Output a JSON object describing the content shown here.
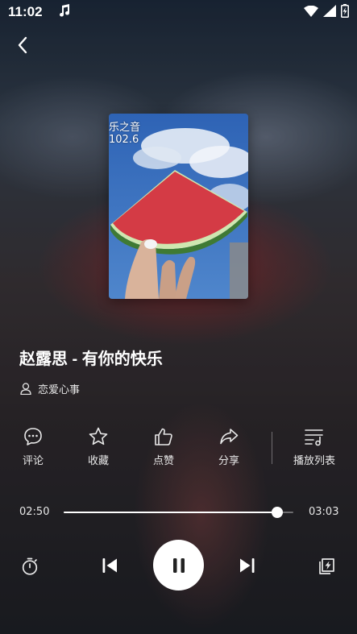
{
  "status": {
    "time": "11:02",
    "music_indicator": "music-note-icon",
    "icons": [
      "wifi-icon",
      "signal-icon",
      "battery-charging-icon"
    ]
  },
  "navigation": {
    "back_icon": "chevron-left-icon"
  },
  "cover": {
    "overlay_line1": "乐之音",
    "overlay_line2": "102.6"
  },
  "song": {
    "title": "赵露思 - 有你的快乐",
    "artist": "恋爱心事"
  },
  "actions": [
    {
      "id": "comment",
      "label": "评论",
      "icon": "comment-icon"
    },
    {
      "id": "favorite",
      "label": "收藏",
      "icon": "star-icon"
    },
    {
      "id": "like",
      "label": "点赞",
      "icon": "thumbs-up-icon"
    },
    {
      "id": "share",
      "label": "分享",
      "icon": "share-icon"
    },
    {
      "id": "playlist",
      "label": "播放列表",
      "icon": "playlist-icon"
    }
  ],
  "progress": {
    "current": "02:50",
    "total": "03:03",
    "fraction": 0.929
  },
  "controls": {
    "timer_icon": "timer-icon",
    "prev_icon": "skip-previous-icon",
    "play_state_icon": "pause-icon",
    "next_icon": "skip-next-icon",
    "mode_icon": "lightning-mode-icon"
  },
  "colors": {
    "accent": "#ffffff",
    "watermelon": "#d43b45",
    "sky": "#3c76c2"
  }
}
